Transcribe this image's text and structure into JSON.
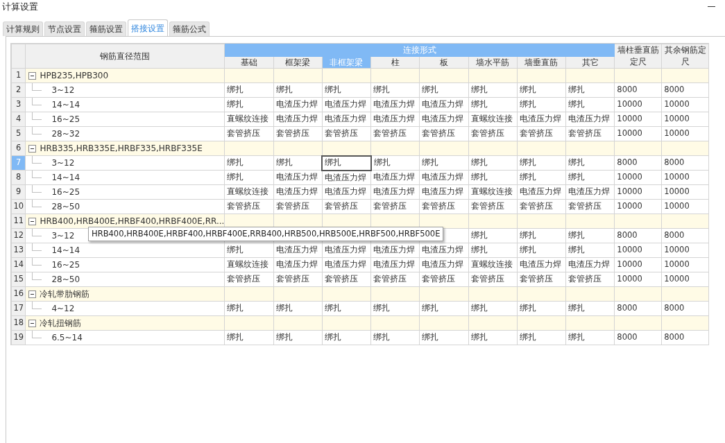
{
  "window": {
    "title": "计算设置"
  },
  "tabs": [
    {
      "label": "计算规则",
      "selected": false
    },
    {
      "label": "节点设置",
      "selected": false
    },
    {
      "label": "箍筋设置",
      "selected": false
    },
    {
      "label": "搭接设置",
      "selected": true
    },
    {
      "label": "箍筋公式",
      "selected": false
    }
  ],
  "table": {
    "range_header": "钢筋直径范围",
    "group_header": "连接形式",
    "columns": [
      {
        "label": "基础",
        "selected": false
      },
      {
        "label": "框架梁",
        "selected": false
      },
      {
        "label": "非框架梁",
        "selected": true
      },
      {
        "label": "柱",
        "selected": false
      },
      {
        "label": "板",
        "selected": false
      },
      {
        "label": "墙水平筋",
        "selected": false
      },
      {
        "label": "墙垂直筋",
        "selected": false
      },
      {
        "label": "其它",
        "selected": false
      }
    ],
    "extra_columns": [
      [
        "墙柱垂直筋",
        "定尺"
      ],
      [
        "其余钢筋定",
        "尺"
      ]
    ],
    "rows": [
      {
        "number": "1",
        "kind": "group",
        "label": "HPB235,HPB300",
        "expanded": true,
        "selected": false
      },
      {
        "number": "2",
        "kind": "item",
        "label": "3~12",
        "selected": false,
        "cells": [
          "绑扎",
          "绑扎",
          "绑扎",
          "绑扎",
          "绑扎",
          "绑扎",
          "绑扎",
          "绑扎",
          "8000",
          "8000"
        ]
      },
      {
        "number": "3",
        "kind": "item",
        "label": "14~14",
        "selected": false,
        "cells": [
          "绑扎",
          "电渣压力焊",
          "电渣压力焊",
          "电渣压力焊",
          "电渣压力焊",
          "绑扎",
          "绑扎",
          "绑扎",
          "10000",
          "10000"
        ]
      },
      {
        "number": "4",
        "kind": "item",
        "label": "16~25",
        "selected": false,
        "cells": [
          "直螺纹连接",
          "电渣压力焊",
          "电渣压力焊",
          "电渣压力焊",
          "电渣压力焊",
          "直螺纹连接",
          "电渣压力焊",
          "电渣压力焊",
          "10000",
          "10000"
        ]
      },
      {
        "number": "5",
        "kind": "item",
        "label": "28~32",
        "selected": false,
        "cells": [
          "套管挤压",
          "套管挤压",
          "套管挤压",
          "套管挤压",
          "套管挤压",
          "套管挤压",
          "套管挤压",
          "套管挤压",
          "10000",
          "10000"
        ]
      },
      {
        "number": "6",
        "kind": "group",
        "label": "HRB335,HRB335E,HRBF335,HRBF335E",
        "expanded": true,
        "selected": false
      },
      {
        "number": "7",
        "kind": "item",
        "label": "3~12",
        "selected": true,
        "cells": [
          "绑扎",
          "绑扎",
          "绑扎",
          "绑扎",
          "绑扎",
          "绑扎",
          "绑扎",
          "绑扎",
          "8000",
          "8000"
        ]
      },
      {
        "number": "8",
        "kind": "item",
        "label": "14~14",
        "selected": false,
        "cells": [
          "绑扎",
          "电渣压力焊",
          "电渣压力焊",
          "电渣压力焊",
          "电渣压力焊",
          "绑扎",
          "绑扎",
          "绑扎",
          "10000",
          "10000"
        ]
      },
      {
        "number": "9",
        "kind": "item",
        "label": "16~25",
        "selected": false,
        "cells": [
          "直螺纹连接",
          "电渣压力焊",
          "电渣压力焊",
          "电渣压力焊",
          "电渣压力焊",
          "直螺纹连接",
          "电渣压力焊",
          "电渣压力焊",
          "10000",
          "10000"
        ]
      },
      {
        "number": "10",
        "kind": "item",
        "label": "28~50",
        "selected": false,
        "cells": [
          "套管挤压",
          "套管挤压",
          "套管挤压",
          "套管挤压",
          "套管挤压",
          "套管挤压",
          "套管挤压",
          "套管挤压",
          "10000",
          "10000"
        ]
      },
      {
        "number": "11",
        "kind": "group",
        "label": "HRB400,HRB400E,HRBF400,HRBF400E,RR...",
        "expanded": true,
        "selected": false
      },
      {
        "number": "12",
        "kind": "item",
        "label": "3~12",
        "selected": false,
        "cells": [
          null,
          null,
          null,
          null,
          null,
          "绑扎",
          "绑扎",
          "绑扎",
          "8000",
          "8000"
        ]
      },
      {
        "number": "13",
        "kind": "item",
        "label": "14~14",
        "selected": false,
        "cells": [
          "绑扎",
          "电渣压力焊",
          "电渣压力焊",
          "电渣压力焊",
          "电渣压力焊",
          "绑扎",
          "绑扎",
          "绑扎",
          "10000",
          "10000"
        ]
      },
      {
        "number": "14",
        "kind": "item",
        "label": "16~25",
        "selected": false,
        "cells": [
          "直螺纹连接",
          "电渣压力焊",
          "电渣压力焊",
          "电渣压力焊",
          "电渣压力焊",
          "直螺纹连接",
          "电渣压力焊",
          "电渣压力焊",
          "10000",
          "10000"
        ]
      },
      {
        "number": "15",
        "kind": "item",
        "label": "28~50",
        "selected": false,
        "cells": [
          "套管挤压",
          "套管挤压",
          "套管挤压",
          "套管挤压",
          "套管挤压",
          "套管挤压",
          "套管挤压",
          "套管挤压",
          "10000",
          "10000"
        ]
      },
      {
        "number": "16",
        "kind": "group",
        "label": "冷轧带肋钢筋",
        "expanded": true,
        "selected": false
      },
      {
        "number": "17",
        "kind": "item",
        "label": "4~12",
        "selected": false,
        "cells": [
          "绑扎",
          "绑扎",
          "绑扎",
          "绑扎",
          "绑扎",
          "绑扎",
          "绑扎",
          "绑扎",
          "8000",
          "8000"
        ]
      },
      {
        "number": "18",
        "kind": "group",
        "label": "冷轧扭钢筋",
        "expanded": true,
        "selected": false
      },
      {
        "number": "19",
        "kind": "item",
        "label": "6.5~14",
        "selected": false,
        "cells": [
          "绑扎",
          "绑扎",
          "绑扎",
          "绑扎",
          "绑扎",
          "绑扎",
          "绑扎",
          "绑扎",
          "8000",
          "8000"
        ]
      }
    ],
    "tooltip": "HRB400,HRB400E,HRBF400,HRBF400E,RRB400,HRB500,HRB500E,HRBF500,HRBF500E"
  }
}
